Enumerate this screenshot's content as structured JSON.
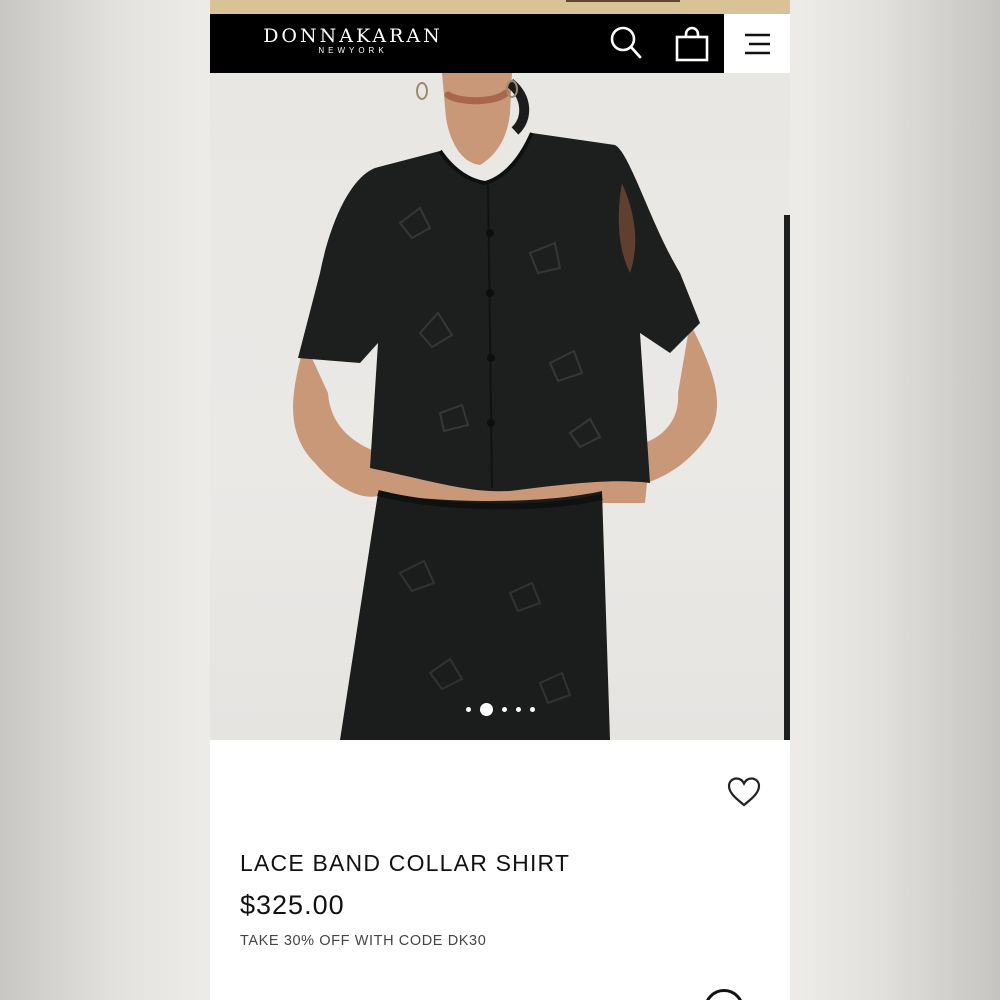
{
  "header": {
    "brand": "DONNAKARAN",
    "brand_sub": "NEWYORK",
    "search_icon": "search-icon",
    "bag_icon": "shopping-bag-icon",
    "menu_icon": "hamburger-menu-icon"
  },
  "gallery": {
    "image": "model wearing black lace band collar shirt and matching black lace skirt",
    "slide_count": 5,
    "active_slide": 2
  },
  "product": {
    "title": "LACE BAND COLLAR SHIRT",
    "price": "$325.00",
    "promo": "TAKE 30% OFF WITH CODE DK30",
    "favorite_icon": "heart-icon"
  },
  "colors": {
    "header_bg": "#000000",
    "promo_strip": "#d9c296",
    "garment": "#1c1f1e"
  }
}
